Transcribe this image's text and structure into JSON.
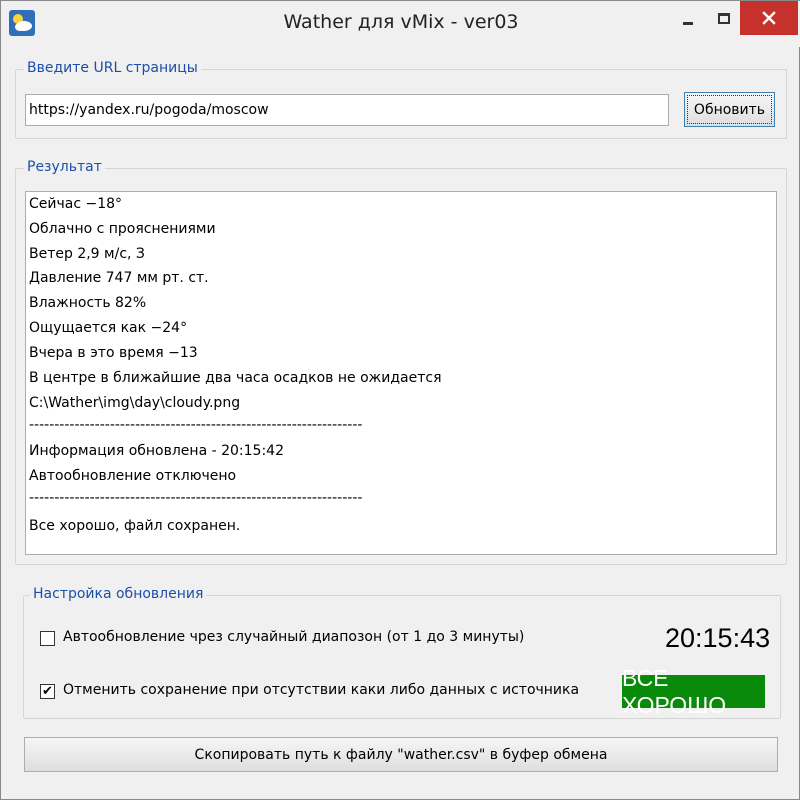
{
  "window": {
    "title": "Wather для vMix - ver03",
    "app_icon": "weather-cloud-sun-icon",
    "controls": [
      "minimize-icon",
      "maximize-icon",
      "close-icon"
    ],
    "close_color": "#c7312c"
  },
  "url_group": {
    "label": "Введите URL страницы",
    "url_value": "https://yandex.ru/pogoda/moscow",
    "refresh_label": "Обновить"
  },
  "result_group": {
    "label": "Результат",
    "lines": [
      "Сейчас −18°",
      "Облачно с прояснениями",
      "Ветер 2,9 м/с, З",
      "Давление 747 мм рт. ст.",
      "Влажность 82%",
      "Ощущается как −24°",
      "Вчера в это время −13",
      "В центре в ближайшие два часа осадков не ожидается",
      "C:\\Wather\\img\\day\\cloudy.png",
      "------------------------------------------------------------------",
      "Информация обновлена - 20:15:42",
      "Автообновление отключено",
      "------------------------------------------------------------------",
      "Все хорошо, файл сохранен."
    ]
  },
  "settings_group": {
    "label": "Настройка обновления",
    "auto_update_label": "Автообновление чрез случайный диапозон (от 1 до 3 минуты)",
    "auto_update_checked": false,
    "cancel_save_label": "Отменить сохранение при отсутствии каки либо данных с источника",
    "cancel_save_checked": true,
    "check_mark": "✔",
    "clock": "20:15:43",
    "status": "ВСЕ ХОРОШО",
    "status_color": "#0a8a0a"
  },
  "copy_button_label": "Скопировать путь к файлу \"wather.csv\" в буфер обмена"
}
